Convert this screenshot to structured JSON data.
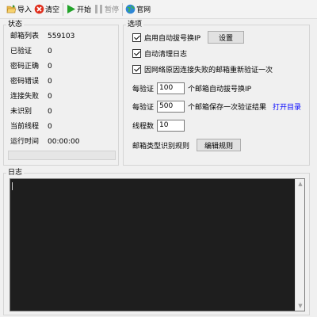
{
  "toolbar": {
    "import_label": "导入",
    "clear_label": "清空",
    "start_label": "开始",
    "pause_label": "暂停",
    "website_label": "官网"
  },
  "status": {
    "title": "状态",
    "rows": [
      {
        "label": "邮箱列表",
        "value": "559103"
      },
      {
        "label": "已验证",
        "value": "0"
      },
      {
        "label": "密码正确",
        "value": "0"
      },
      {
        "label": "密码错误",
        "value": "0"
      },
      {
        "label": "连接失败",
        "value": "0"
      },
      {
        "label": "未识别",
        "value": "0"
      },
      {
        "label": "当前线程",
        "value": "0"
      },
      {
        "label": "运行时间",
        "value": "00:00:00"
      }
    ],
    "progress": 0
  },
  "options": {
    "title": "选项",
    "auto_dial_label": "启用自动拔号换IP",
    "auto_dial_checked": true,
    "settings_button": "设置",
    "auto_clean_label": "自动清理日志",
    "auto_clean_checked": true,
    "reverify_label": "因网络原因连接失败的邮箱重新验证一次",
    "reverify_checked": true,
    "dial_every_prefix": "每验证",
    "dial_every_value": "100",
    "dial_every_suffix": "个邮箱自动拔号换IP",
    "save_every_prefix": "每验证",
    "save_every_value": "500",
    "save_every_suffix": "个邮箱保存一次验证结果",
    "open_dir_link": "打开目录",
    "threads_label": "线程数",
    "threads_value": "10",
    "mail_type_label": "邮箱类型识别规则",
    "edit_rules_button": "编辑规则"
  },
  "log": {
    "title": "日志"
  }
}
